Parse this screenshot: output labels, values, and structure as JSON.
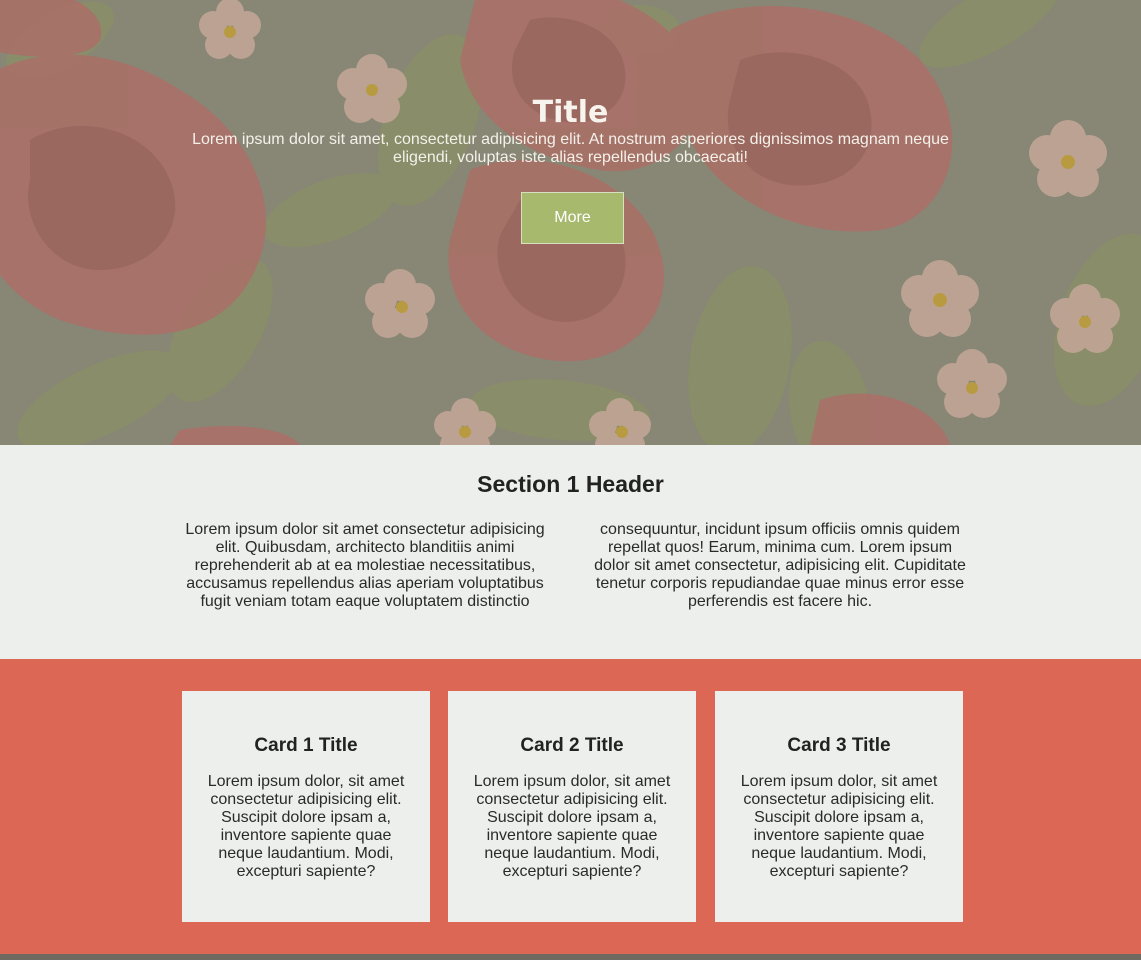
{
  "hero": {
    "title": "Title",
    "text": "Lorem ipsum dolor sit amet, consectetur adipisicing elit. At nostrum asperiores dignissimos magnam neque eligendi, voluptas iste alias repellendus obcaecati!",
    "button_label": "More",
    "colors": {
      "button": "#a7b96d",
      "rose": "#b8756a",
      "leaf": "#8f9669",
      "blossom": "#d8b8a6"
    }
  },
  "section1": {
    "header": "Section 1 Header",
    "col_left": "Lorem ipsum dolor sit amet consectetur adipisicing elit. Quibusdam, architecto blanditiis animi reprehenderit ab at ea molestiae necessitatibus, accusamus repellendus alias aperiam voluptatibus fugit veniam totam eaque voluptatem distinctio",
    "col_right": "consequuntur, incidunt ipsum officiis omnis quidem repellat quos! Earum, minima cum. Lorem ipsum dolor sit amet consectetur, adipisicing elit. Cupiditate tenetur corporis repudiandae quae minus error esse perferendis est facere hic."
  },
  "cards": {
    "background": "#dd6755",
    "items": [
      {
        "title": "Card 1 Title",
        "text": "Lorem ipsum dolor, sit amet consectetur adipisicing elit. Suscipit dolore ipsam a, inventore sapiente quae neque laudantium. Modi, excepturi sapiente?"
      },
      {
        "title": "Card 2 Title",
        "text": "Lorem ipsum dolor, sit amet consectetur adipisicing elit. Suscipit dolore ipsam a, inventore sapiente quae neque laudantium. Modi, excepturi sapiente?"
      },
      {
        "title": "Card 3 Title",
        "text": "Lorem ipsum dolor, sit amet consectetur adipisicing elit. Suscipit dolore ipsam a, inventore sapiente quae neque laudantium. Modi, excepturi sapiente?"
      }
    ]
  }
}
